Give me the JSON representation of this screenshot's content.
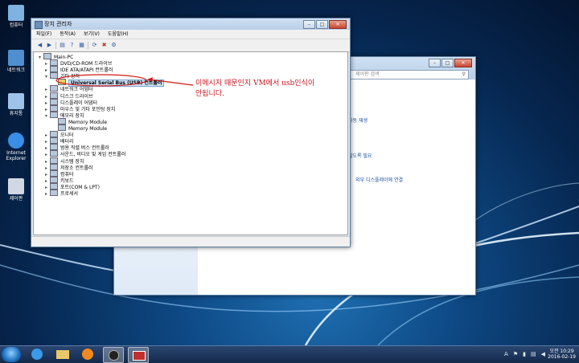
{
  "desktop": {
    "icons": [
      {
        "label": "컴퓨터",
        "color": "#7fb2e0"
      },
      {
        "label": "네트워크",
        "color": "#4f8fd0"
      },
      {
        "label": "휴지통",
        "color": "#9fc3e8"
      },
      {
        "label": "Internet Explorer",
        "color": "#3a8ee6"
      },
      {
        "label": "제어판",
        "color": "#d0d8e4"
      }
    ]
  },
  "back_window": {
    "search_placeholder": "제어판 검색",
    "links": [
      "자동 재생",
      "않도록 필요",
      "외부 디스플레이에 연결"
    ]
  },
  "device_manager": {
    "title": "장치 관리자",
    "menu": [
      "파일(F)",
      "동작(A)",
      "보기(V)",
      "도움말(H)"
    ],
    "toolbar_icons": [
      "back-icon",
      "forward-icon",
      "properties-icon",
      "help-icon",
      "scan-icon",
      "update-icon",
      "disable-icon",
      "uninstall-icon"
    ],
    "tree": {
      "root": "Main-PC",
      "items": [
        {
          "label": "DVD/CD-ROM 드라이브",
          "expander": "▸",
          "depth": 1
        },
        {
          "label": "IDE ATA/ATAPI 컨트롤러",
          "expander": "▸",
          "depth": 1
        },
        {
          "label": "기타 장치",
          "expander": "▾",
          "depth": 1
        },
        {
          "label": "Universal Serial Bus (USB) 컨트롤러",
          "expander": "",
          "depth": 2,
          "selected": true
        },
        {
          "label": "네트워크 어댑터",
          "expander": "▸",
          "depth": 1
        },
        {
          "label": "디스크 드라이브",
          "expander": "▸",
          "depth": 1
        },
        {
          "label": "디스플레이 어댑터",
          "expander": "▸",
          "depth": 1
        },
        {
          "label": "마우스 및 기타 포인팅 장치",
          "expander": "▸",
          "depth": 1
        },
        {
          "label": "메모리 장치",
          "expander": "▾",
          "depth": 1
        },
        {
          "label": "Memory Module",
          "expander": "",
          "depth": 2
        },
        {
          "label": "Memory Module",
          "expander": "",
          "depth": 2
        },
        {
          "label": "모니터",
          "expander": "▸",
          "depth": 1
        },
        {
          "label": "배터리",
          "expander": "▸",
          "depth": 1
        },
        {
          "label": "범용 직렬 버스 컨트롤러",
          "expander": "▸",
          "depth": 1
        },
        {
          "label": "사운드, 비디오 및 게임 컨트롤러",
          "expander": "▸",
          "depth": 1
        },
        {
          "label": "시스템 장치",
          "expander": "▸",
          "depth": 1
        },
        {
          "label": "저장소 컨트롤러",
          "expander": "▸",
          "depth": 1
        },
        {
          "label": "컴퓨터",
          "expander": "▸",
          "depth": 1
        },
        {
          "label": "키보드",
          "expander": "▸",
          "depth": 1
        },
        {
          "label": "포트(COM & LPT)",
          "expander": "▸",
          "depth": 1
        },
        {
          "label": "프로세서",
          "expander": "▸",
          "depth": 1
        }
      ]
    }
  },
  "annotation": {
    "line1": "이메시지 때문인지 VM에서  usb인식이",
    "line2": "안됩니다."
  },
  "taskbar": {
    "time": "오전 10:29",
    "date": "2016-02-19"
  }
}
